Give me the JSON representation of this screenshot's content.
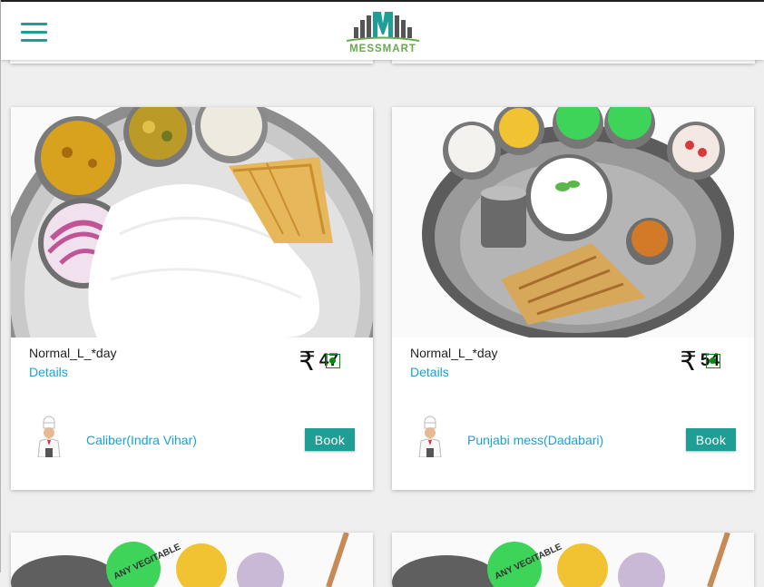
{
  "header": {
    "menu_icon": "hamburger-menu-icon",
    "logo_text": "MESSMART"
  },
  "colors": {
    "accent": "#1f9e95",
    "link": "#1ba1d6",
    "veg": "#0b8a12",
    "logo_green": "#6aa84f"
  },
  "cards": [
    {
      "title": "Normal_L_*day",
      "details_label": "Details",
      "currency_symbol": "₹",
      "price": "47",
      "veg_icon": "veg-indicator-icon",
      "mess_name": "Caliber(Indra Vihar)",
      "book_label": "Book"
    },
    {
      "title": "Normal_L_*day",
      "details_label": "Details",
      "currency_symbol": "₹",
      "price": "54",
      "veg_icon": "veg-indicator-icon",
      "mess_name": "Punjabi mess(Dadabari)",
      "book_label": "Book"
    }
  ],
  "food_image_labels": {
    "tag": "ANY VEGITABLE"
  }
}
